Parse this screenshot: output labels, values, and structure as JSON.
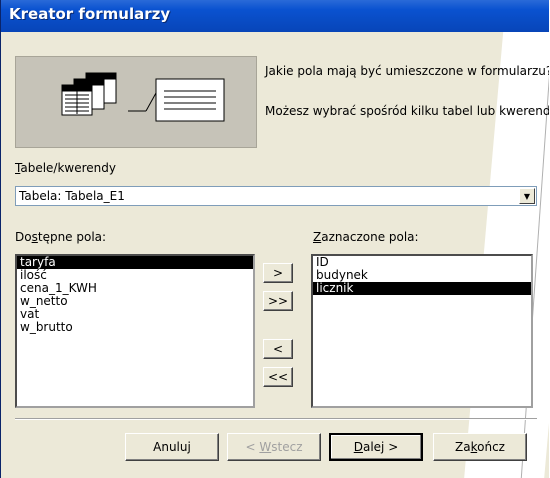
{
  "window": {
    "title": "Kreator formularzy"
  },
  "prompt": {
    "line1": "Jakie pola mają być umieszczone w formularzu?",
    "line2": "Możesz wybrać spośród kilku tabel lub kwerend."
  },
  "source": {
    "label_first": "T",
    "label_rest": "abele/kwerendy",
    "selected": "Tabela: Tabela_E1"
  },
  "available": {
    "label_pre": "Do",
    "label_u": "s",
    "label_post": "tępne pola:",
    "fields": [
      "taryfa",
      "ilość",
      "cena_1_KWH",
      "w_netto",
      "vat",
      "w_brutto"
    ],
    "selected_index": 0
  },
  "chosen": {
    "label_first": "Z",
    "label_rest": "aznaczone pola:",
    "fields": [
      "ID",
      "budynek",
      "licznik"
    ],
    "selected_index": 2
  },
  "move_buttons": {
    "add": ">",
    "add_all": ">>",
    "remove": "<",
    "remove_all": "<<"
  },
  "buttons": {
    "cancel": "Anuluj",
    "back_pre": "< ",
    "back_u": "W",
    "back_post": "stecz",
    "next_u": "D",
    "next_post": "alej >",
    "finish_pre": "Za",
    "finish_u": "k",
    "finish_post": "ończ"
  }
}
